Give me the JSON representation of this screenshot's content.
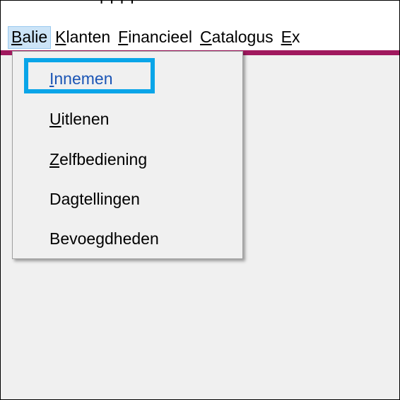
{
  "window": {
    "title_fragment": "r                                                   r                    r          r"
  },
  "menubar": {
    "items": [
      {
        "accel": "B",
        "rest": "alie"
      },
      {
        "accel": "K",
        "rest": "lanten"
      },
      {
        "accel": "F",
        "rest": "inancieel"
      },
      {
        "accel": "C",
        "rest": "atalogus"
      },
      {
        "accel": "E",
        "rest": "x"
      }
    ]
  },
  "dropdown": {
    "items": [
      {
        "accel": "I",
        "rest": "nnemen",
        "selected": true
      },
      {
        "accel": "U",
        "rest": "itlenen",
        "selected": false
      },
      {
        "accel": "Z",
        "rest": "elfbediening",
        "selected": false
      },
      {
        "accel": "",
        "rest": "Dagtellingen",
        "selected": false
      },
      {
        "accel": "",
        "rest": "Bevoegdheden",
        "selected": false
      }
    ]
  },
  "colors": {
    "accent_bar": "#a0195e",
    "highlight_border": "#0aa5e8",
    "selected_text": "#1b55b5",
    "active_menu_bg": "#cce4f7"
  }
}
